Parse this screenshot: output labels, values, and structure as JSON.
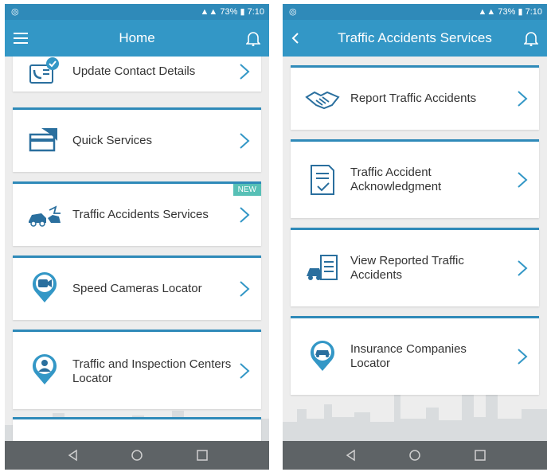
{
  "left_screen": {
    "status_time": "7:10",
    "status_battery": "73%",
    "title": "Home",
    "items": [
      {
        "label": "Update Contact Details"
      },
      {
        "label": "Quick Services"
      },
      {
        "label": "Traffic Accidents Services",
        "badge": "NEW"
      },
      {
        "label": "Speed Cameras Locator"
      },
      {
        "label": "Traffic and Inspection Centers Locator"
      }
    ]
  },
  "right_screen": {
    "status_time": "7:10",
    "status_battery": "73%",
    "title": "Traffic Accidents Services",
    "items": [
      {
        "label": "Report Traffic Accidents"
      },
      {
        "label": "Traffic Accident Acknowledgment"
      },
      {
        "label": "View Reported Traffic Accidents"
      },
      {
        "label": "Insurance Companies Locator"
      }
    ]
  },
  "colors": {
    "app_bar": "#3397c6",
    "status_bar": "#2f8ab9",
    "accent": "#2f8ab9",
    "badge": "#57c0b6"
  }
}
